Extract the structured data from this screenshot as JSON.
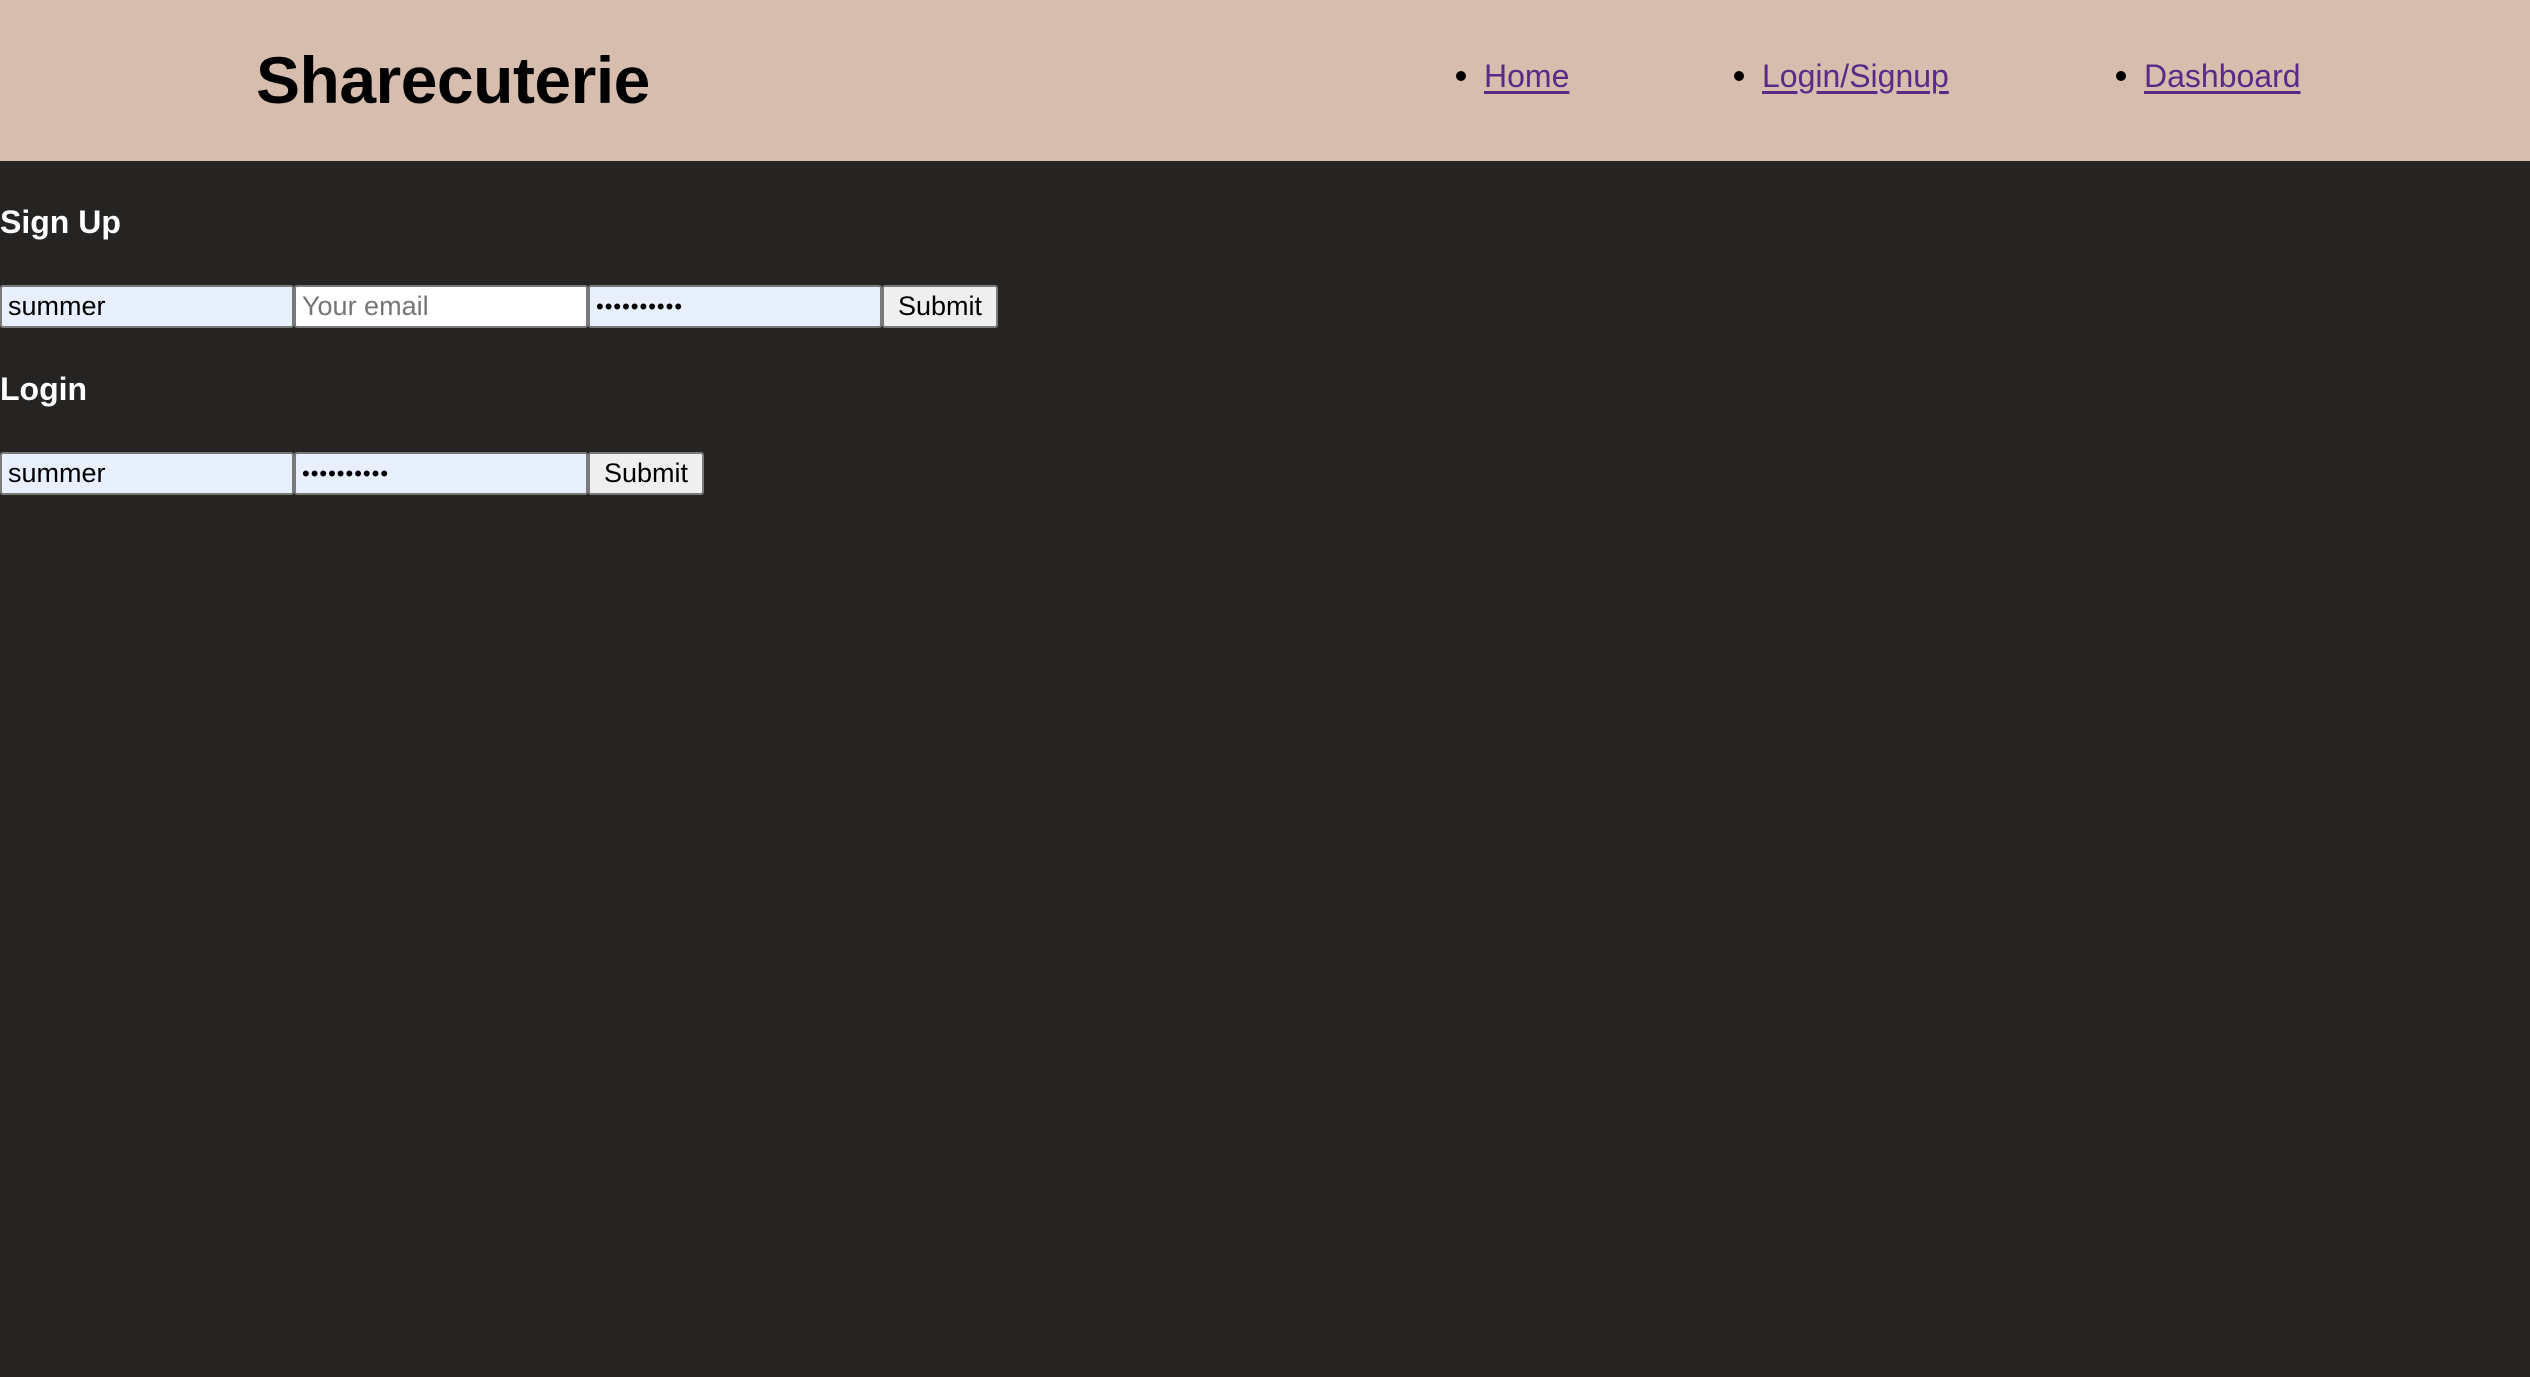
{
  "header": {
    "brand": "Sharecuterie",
    "nav": [
      {
        "label": "Home"
      },
      {
        "label": "Login/Signup"
      },
      {
        "label": "Dashboard"
      }
    ]
  },
  "signup": {
    "title": "Sign Up",
    "username_value": "summer",
    "email_placeholder": "Your email",
    "email_value": "",
    "password_value": "••••••••••",
    "submit_label": "Submit"
  },
  "login": {
    "title": "Login",
    "username_value": "summer",
    "password_value": "••••••••••",
    "submit_label": "Submit"
  },
  "colors": {
    "header_bg": "#d6bdad",
    "page_bg": "#252423",
    "link": "#5a2a86",
    "autofill_bg": "#e8f0fe"
  }
}
